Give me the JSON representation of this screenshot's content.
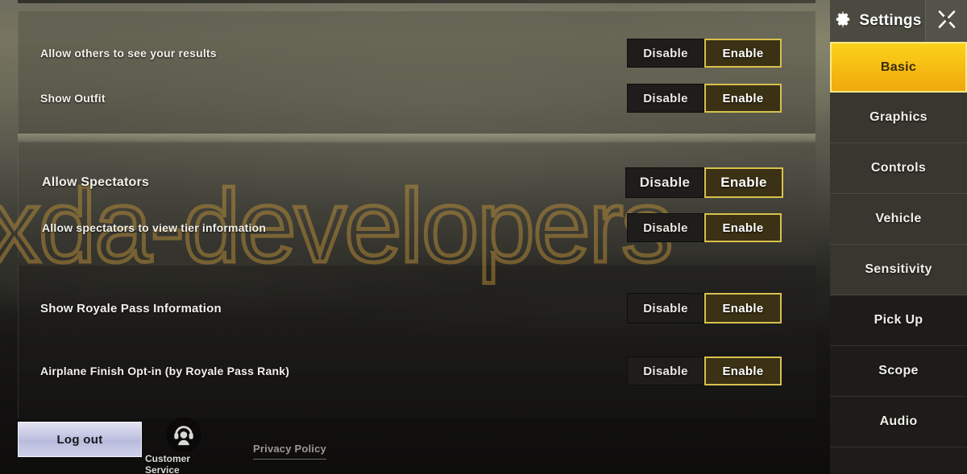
{
  "watermark": {
    "text": "xda-developers"
  },
  "settings_rows": [
    {
      "label": "Allow others to see your results",
      "options": [
        "Disable",
        "Enable"
      ],
      "selected": "Enable",
      "size": "s"
    },
    {
      "label": "Show Outfit",
      "options": [
        "Disable",
        "Enable"
      ],
      "selected": "Enable",
      "size": "s"
    },
    {
      "label": "Allow Spectators",
      "options": [
        "Disable",
        "Enable"
      ],
      "selected": "Enable",
      "size": "m"
    },
    {
      "label": "Allow spectators to view tier information",
      "options": [
        "Disable",
        "Enable"
      ],
      "selected": "Enable",
      "size": "s"
    },
    {
      "label": "Show Royale Pass Information",
      "options": [
        "Disable",
        "Enable"
      ],
      "selected": "Enable",
      "size": "l"
    },
    {
      "label": "Airplane Finish Opt-in (by Royale Pass Rank)",
      "options": [
        "Disable",
        "Enable"
      ],
      "selected": "Enable",
      "size": "s"
    }
  ],
  "footer": {
    "logout_label": "Log out",
    "customer_service_label": "Customer Service",
    "customer_service_icon": "headset-support-icon",
    "privacy_policy_label": "Privacy Policy"
  },
  "sidebar": {
    "title": "Settings",
    "gear_icon": "gear-icon",
    "close_icon": "close-icon",
    "items": [
      {
        "label": "Basic",
        "active": true
      },
      {
        "label": "Graphics",
        "active": false
      },
      {
        "label": "Controls",
        "active": false
      },
      {
        "label": "Vehicle",
        "active": false
      },
      {
        "label": "Sensitivity",
        "active": false
      },
      {
        "label": "Pick Up",
        "active": false
      },
      {
        "label": "Scope",
        "active": false
      },
      {
        "label": "Audio",
        "active": false
      }
    ]
  },
  "colors": {
    "accent_yellow": "#f5c518",
    "selected_border": "#d8c14e",
    "selected_fill": "#3b3114",
    "panel_dark": "#1e1d1b",
    "watermark_gold": "#c4963a"
  }
}
